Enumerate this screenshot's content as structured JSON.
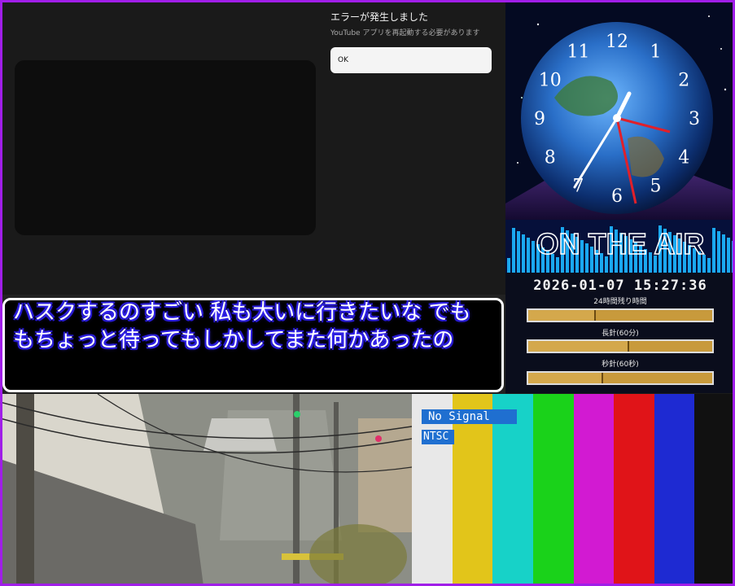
{
  "youtube": {
    "error_title": "エラーが発生しました",
    "error_message": "YouTube アプリを再起動する必要があります",
    "ok_label": "OK"
  },
  "clock": {
    "numbers": [
      "12",
      "1",
      "2",
      "3",
      "4",
      "5",
      "6",
      "7",
      "8",
      "9",
      "10",
      "11"
    ],
    "banner_text": "ON THE AIR",
    "accent_color": "#e0202a"
  },
  "timer": {
    "datetime": "2026-01-07 15:27:36",
    "rows": [
      {
        "label": "24時間残り時間",
        "fraction": 0.36
      },
      {
        "label": "長針(60分)",
        "fraction": 0.54
      },
      {
        "label": "秒針(60秒)",
        "fraction": 0.4
      }
    ]
  },
  "subtitles": {
    "line1": "ハスクするのすごい 私も大いに行きたいな でも",
    "line2": "もちょっと待ってもしかしてまた何かあったの"
  },
  "signal": {
    "no_signal": "No Signal",
    "standard": "NTSC",
    "bar_colors": [
      "#e8e8e8",
      "#e2c51a",
      "#17d2c8",
      "#1ad21a",
      "#d21ad2",
      "#e01418",
      "#1e2ad2",
      "#111111"
    ]
  }
}
